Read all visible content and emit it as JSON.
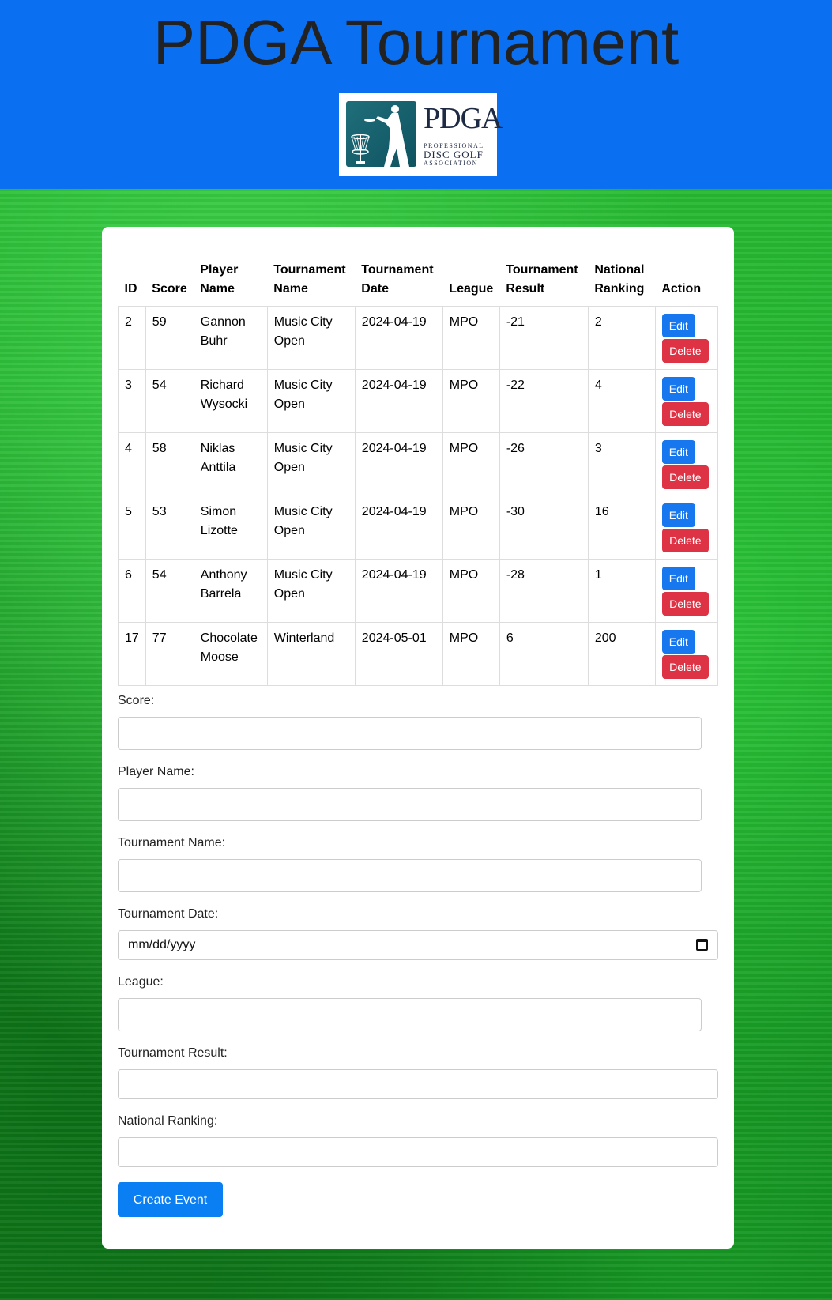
{
  "header": {
    "title": "PDGA Tournament",
    "logo": {
      "brand": "PDGA",
      "line1": "PROFESSIONAL",
      "line2": "DISC GOLF",
      "line3": "ASSOCIATION"
    }
  },
  "table": {
    "headers": [
      "ID",
      "Score",
      "Player Name",
      "Tournament Name",
      "Tournament Date",
      "League",
      "Tournament Result",
      "National Ranking",
      "Action"
    ],
    "rows": [
      {
        "id": "2",
        "score": "59",
        "player": "Gannon Buhr",
        "tournament": "Music City Open",
        "date": "2024-04-19",
        "league": "MPO",
        "result": "-21",
        "ranking": "2"
      },
      {
        "id": "3",
        "score": "54",
        "player": "Richard Wysocki",
        "tournament": "Music City Open",
        "date": "2024-04-19",
        "league": "MPO",
        "result": "-22",
        "ranking": "4"
      },
      {
        "id": "4",
        "score": "58",
        "player": "Niklas Anttila",
        "tournament": "Music City Open",
        "date": "2024-04-19",
        "league": "MPO",
        "result": "-26",
        "ranking": "3"
      },
      {
        "id": "5",
        "score": "53",
        "player": "Simon Lizotte",
        "tournament": "Music City Open",
        "date": "2024-04-19",
        "league": "MPO",
        "result": "-30",
        "ranking": "16"
      },
      {
        "id": "6",
        "score": "54",
        "player": "Anthony Barrela",
        "tournament": "Music City Open",
        "date": "2024-04-19",
        "league": "MPO",
        "result": "-28",
        "ranking": "1"
      },
      {
        "id": "17",
        "score": "77",
        "player": "Chocolate Moose",
        "tournament": "Winterland",
        "date": "2024-05-01",
        "league": "MPO",
        "result": "6",
        "ranking": "200"
      }
    ],
    "edit_label": "Edit",
    "delete_label": "Delete"
  },
  "form": {
    "score_label": "Score:",
    "player_label": "Player Name:",
    "tournament_label": "Tournament Name:",
    "date_label": "Tournament Date:",
    "date_placeholder": "mm/dd/yyyy",
    "league_label": "League:",
    "result_label": "Tournament Result:",
    "ranking_label": "National Ranking:",
    "submit_label": "Create Event"
  },
  "colors": {
    "header_bg": "#0a6ff1",
    "edit_button": "#1677ee",
    "delete_button": "#de3245",
    "create_button": "#0a7ef3"
  }
}
